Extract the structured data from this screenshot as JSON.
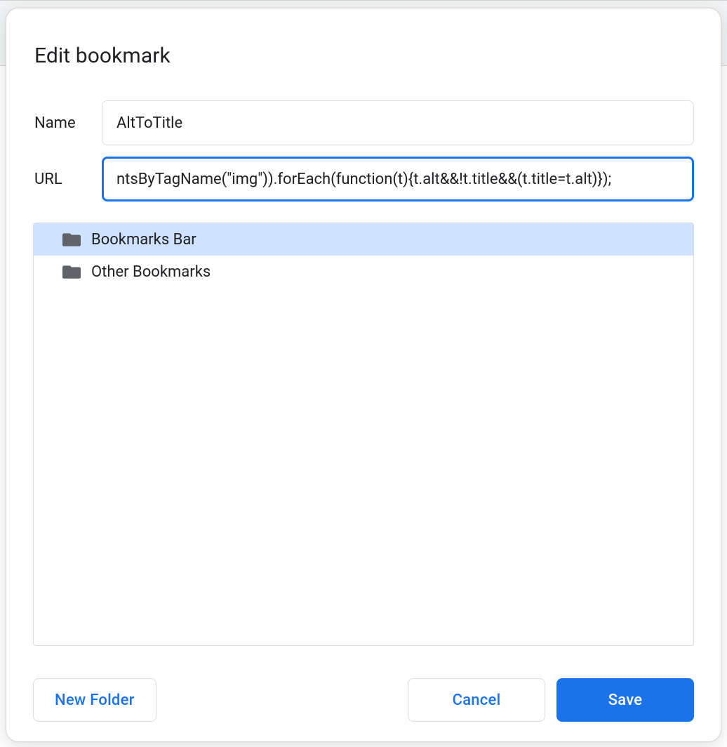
{
  "dialog": {
    "title": "Edit bookmark",
    "name_label": "Name",
    "url_label": "URL",
    "name_value": "AltToTitle",
    "url_value": "ntsByTagName(\"img\")).forEach(function(t){t.alt&&!t.title&&(t.title=t.alt)});"
  },
  "folders": [
    {
      "label": "Bookmarks Bar",
      "selected": true
    },
    {
      "label": "Other Bookmarks",
      "selected": false
    }
  ],
  "buttons": {
    "new_folder": "New Folder",
    "cancel": "Cancel",
    "save": "Save"
  }
}
